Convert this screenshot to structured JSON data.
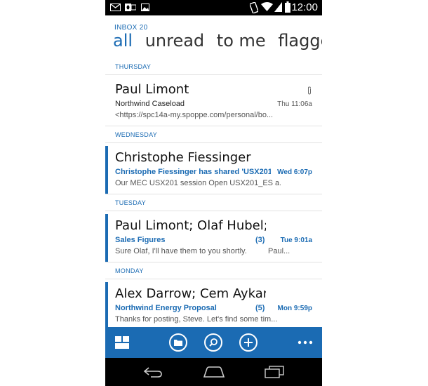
{
  "status_bar": {
    "time": "12:00"
  },
  "inbox": {
    "label": "INBOX",
    "count": "20"
  },
  "pivots": [
    "all",
    "unread",
    "to me",
    "flagged"
  ],
  "groups": [
    {
      "header": "THURSDAY",
      "message": {
        "sender": "Paul Limont",
        "subject": "Northwind Caseload",
        "count": "",
        "time": "Thu 11:06a",
        "preview": "<https://spc14a-my.spoppe.com/personal/bo...",
        "preview_tail": "",
        "unread": false,
        "attachment": true
      }
    },
    {
      "header": "WEDNESDAY",
      "message": {
        "sender": "Christophe Fiessinger",
        "subject": "Christophe Fiessinger has shared 'USX201",
        "count": "",
        "time": "Wed 6:07p",
        "preview": "Our MEC USX201 session Open USX201_ES a...",
        "preview_tail": "",
        "unread": true,
        "attachment": false
      }
    },
    {
      "header": "TUESDAY",
      "message": {
        "sender": "Paul Limont; Olaf Hubel; Te",
        "subject": "Sales Figures",
        "count": "(3)",
        "time": "Tue 9:01a",
        "preview": "Sure Olaf, I'll have them to you shortly.",
        "preview_tail": "Paul...",
        "unread": true,
        "attachment": false
      }
    },
    {
      "header": "MONDAY",
      "message": {
        "sender": "Alex Darrow; Cem Aykan; C",
        "subject": "Northwind Energy Proposal",
        "count": "(5)",
        "time": "Mon 9:59p",
        "preview": "Thanks for posting, Steve. Let's find some tim...",
        "preview_tail": "",
        "unread": true,
        "attachment": false
      }
    }
  ],
  "app_bar": {
    "buttons": [
      "tiles-icon",
      "folder-icon",
      "search-icon",
      "add-icon",
      "more-icon"
    ]
  },
  "colors": {
    "accent": "#1b6bb3",
    "status_bar": "#000000"
  }
}
